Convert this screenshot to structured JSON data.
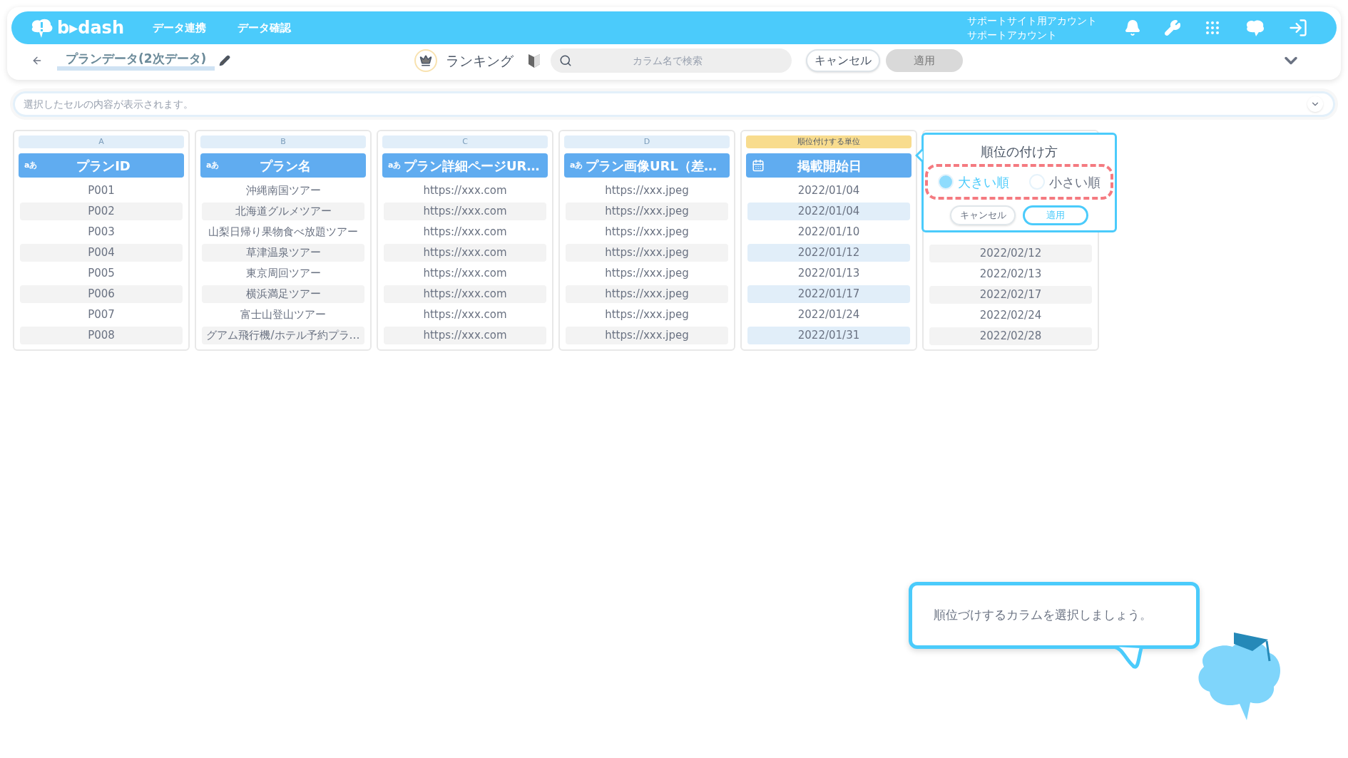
{
  "header": {
    "logo": "b▸dash",
    "nav": [
      "データ連携",
      "データ確認"
    ],
    "account": [
      "サポートサイト用アカウント",
      "サポートアカウント"
    ]
  },
  "toolbar": {
    "title": "プランデータ(2次データ)",
    "mode": "ランキング",
    "search": {
      "placeholder": "カラム名で検索"
    },
    "cancel": "キャンセル",
    "apply": {
      "label": "適用",
      "disabled": true
    }
  },
  "cell_bar": {
    "placeholder": "選択したセルの内容が表示されます。"
  },
  "columns": [
    {
      "letter": "A",
      "kind": "text",
      "type_badge": "aあ",
      "name": "プランID",
      "selected": false,
      "rows": [
        "P001",
        "P002",
        "P003",
        "P004",
        "P005",
        "P006",
        "P007",
        "P008"
      ]
    },
    {
      "letter": "B",
      "kind": "text",
      "type_badge": "aあ",
      "name": "プラン名",
      "selected": false,
      "rows": [
        "沖縄南国ツアー",
        "北海道グルメツアー",
        "山梨日帰り果物食べ放題ツアー",
        "草津温泉ツアー",
        "東京周回ツアー",
        "横浜満足ツアー",
        "富士山登山ツアー",
        "グアム飛行機/ホテル予約プラ…"
      ]
    },
    {
      "letter": "C",
      "kind": "text",
      "type_badge": "aあ",
      "name": "プラン詳細ページUR…",
      "selected": false,
      "rows": [
        "https://xxx.com",
        "https://xxx.com",
        "https://xxx.com",
        "https://xxx.com",
        "https://xxx.com",
        "https://xxx.com",
        "https://xxx.com",
        "https://xxx.com"
      ]
    },
    {
      "letter": "D",
      "kind": "text",
      "type_badge": "aあ",
      "name": "プラン画像URL（差…",
      "selected": false,
      "rows": [
        "https://xxx.jpeg",
        "https://xxx.jpeg",
        "https://xxx.jpeg",
        "https://xxx.jpeg",
        "https://xxx.jpeg",
        "https://xxx.jpeg",
        "https://xxx.jpeg",
        "https://xxx.jpeg"
      ]
    },
    {
      "unit_label": "順位付けする単位",
      "kind": "date",
      "name": "掲載開始日",
      "selected": true,
      "rows": [
        "2022/01/04",
        "2022/01/04",
        "2022/01/10",
        "2022/01/12",
        "2022/01/13",
        "2022/01/17",
        "2022/01/24",
        "2022/01/31"
      ]
    },
    {
      "kind": "hidden",
      "selected": false,
      "rows": [
        "2022/02/12",
        "2022/02/13",
        "2022/02/17",
        "2022/02/24",
        "2022/02/28"
      ]
    }
  ],
  "ranking_popup": {
    "title": "順位の付け方",
    "options": [
      {
        "label": "大きい順",
        "selected": true
      },
      {
        "label": "小さい順",
        "selected": false
      }
    ],
    "cancel": "キャンセル",
    "apply": "適用"
  },
  "guide_bubble": {
    "text": "順位づけするカラムを選択しましょう。"
  }
}
